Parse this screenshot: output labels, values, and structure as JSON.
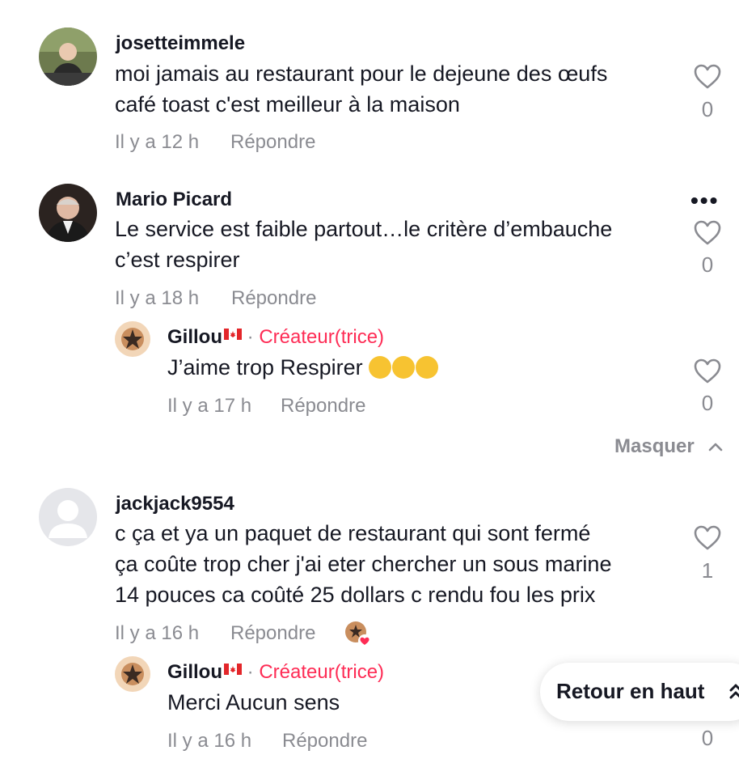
{
  "comments": [
    {
      "username": "josetteimmele",
      "lines": [
        "moi jamais au restaurant pour le dejeune des œufs",
        "café toast c'est meilleur à la maison"
      ],
      "time": "Il y a 12 h",
      "reply_label": "Répondre",
      "likes": "0"
    },
    {
      "username": "Mario Picard",
      "lines": [
        "Le service est faible partout…le critère d’embauche",
        "c’est respirer"
      ],
      "time": "Il y a 18 h",
      "reply_label": "Répondre",
      "likes": "0",
      "more": "•••",
      "reply": {
        "username": "Gillou",
        "flag": "canada-flag",
        "separator": "·",
        "creator_label": "Créateur(trice)",
        "text": "J’aime trop Respirer",
        "emoji": "laughing-tears-emoji ×3",
        "time": "Il y a 17 h",
        "reply_label": "Répondre",
        "likes": "0"
      },
      "hide_label": "Masquer"
    },
    {
      "username": "jackjack9554",
      "lines": [
        "c ça et ya un paquet de restaurant qui sont fermé",
        "ça coûte trop cher j'ai eter chercher un sous marine",
        "14 pouces ca coûté 25 dollars c rendu fou les prix"
      ],
      "time": "Il y a 16 h",
      "reply_label": "Répondre",
      "likes": "1",
      "reply": {
        "username": "Gillou",
        "flag": "canada-flag",
        "separator": "·",
        "creator_label": "Créateur(trice)",
        "text": "Merci Aucun sens",
        "time": "Il y a 16 h",
        "reply_label": "Répondre",
        "likes": "0"
      }
    }
  ],
  "back_to_top": "Retour en haut",
  "colors": {
    "creator": "#fe2c55",
    "muted": "#8a8b91",
    "text": "#161823"
  }
}
